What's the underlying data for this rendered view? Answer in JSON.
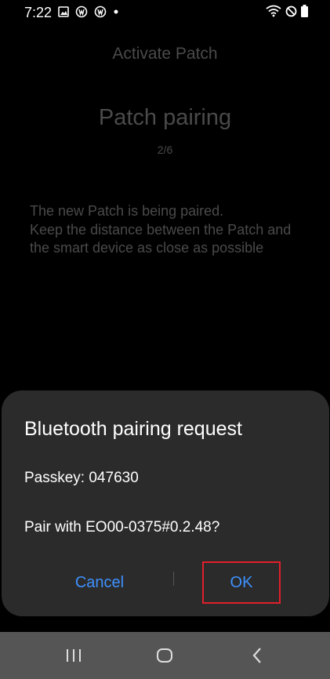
{
  "status_bar": {
    "time": "7:22",
    "left_icons": [
      "image-icon",
      "app-icon",
      "app-icon",
      "dot-icon"
    ],
    "right_icons": [
      "wifi-icon",
      "do-not-disturb-icon",
      "battery-icon"
    ]
  },
  "app": {
    "title": "Activate Patch",
    "heading": "Patch pairing",
    "step": "2/6",
    "instructions": "The new Patch is being paired.\nKeep the distance between the Patch and the smart device as close as possible"
  },
  "dialog": {
    "title": "Bluetooth pairing request",
    "passkey": "Passkey: 047630",
    "question": "Pair with EO00-0375#0.2.48?",
    "cancel_label": "Cancel",
    "ok_label": "OK"
  },
  "nav_bar": {
    "buttons": [
      "recent-apps-icon",
      "home-icon",
      "back-icon"
    ]
  },
  "colors": {
    "accent": "#3e91ff",
    "highlight": "#e0202a",
    "dialog_bg": "#2b2b2b",
    "nav_bg": "#555555"
  }
}
